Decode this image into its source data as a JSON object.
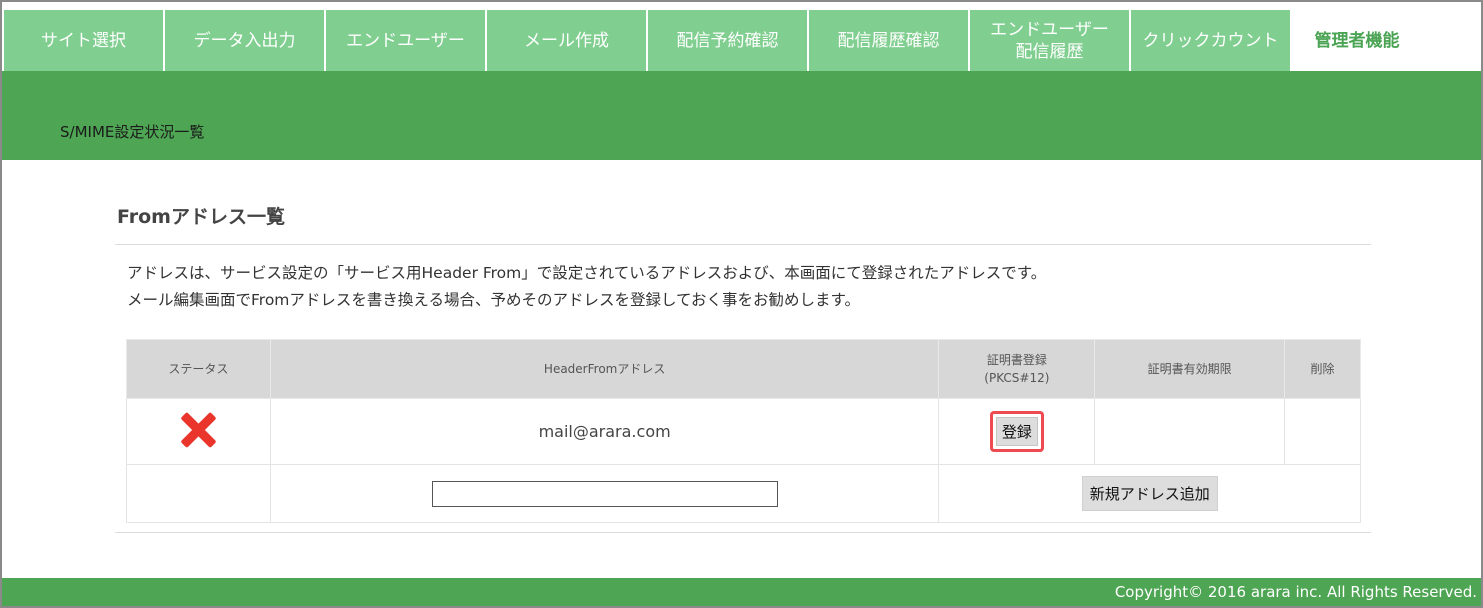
{
  "nav": {
    "tabs": [
      {
        "label": "サイト選択",
        "sub": ""
      },
      {
        "label": "データ入出力",
        "sub": ""
      },
      {
        "label": "エンドユーザー",
        "sub": ""
      },
      {
        "label": "メール作成",
        "sub": ""
      },
      {
        "label": "配信予約確認",
        "sub": ""
      },
      {
        "label": "配信履歴確認",
        "sub": ""
      },
      {
        "label": "エンドユーザー",
        "sub": "配信履歴"
      },
      {
        "label": "クリックカウント",
        "sub": ""
      },
      {
        "label": "管理者機能",
        "sub": ""
      }
    ]
  },
  "page": {
    "breadcrumb": "S/MIME設定状況一覧",
    "section_title": "Fromアドレス一覧",
    "desc_line1": "アドレスは、サービス設定の「サービス用Header From」で設定されているアドレスおよび、本画面にて登録されたアドレスです。",
    "desc_line2": "メール編集画面でFromアドレスを書き換える場合、予めそのアドレスを登録しておく事をお勧めします。"
  },
  "table": {
    "headers": {
      "status": "ステータス",
      "address": "HeaderFromアドレス",
      "cert_line1": "証明書登録",
      "cert_line2": "(PKCS#12)",
      "expiry": "証明書有効期限",
      "delete": "削除"
    },
    "rows": [
      {
        "status_icon": "x-mark-icon",
        "address": "mail@arara.com",
        "register_label": "登録",
        "expiry": "",
        "delete": ""
      }
    ],
    "new_row": {
      "input_value": "",
      "add_label": "新規アドレス追加"
    }
  },
  "footer": {
    "copyright": "Copyright© 2016 arara inc. All Rights Reserved."
  },
  "colors": {
    "green": "#4ea553",
    "tab_green": "#80cf90",
    "error_red": "#e9352b",
    "highlight": "#ee4a52"
  }
}
